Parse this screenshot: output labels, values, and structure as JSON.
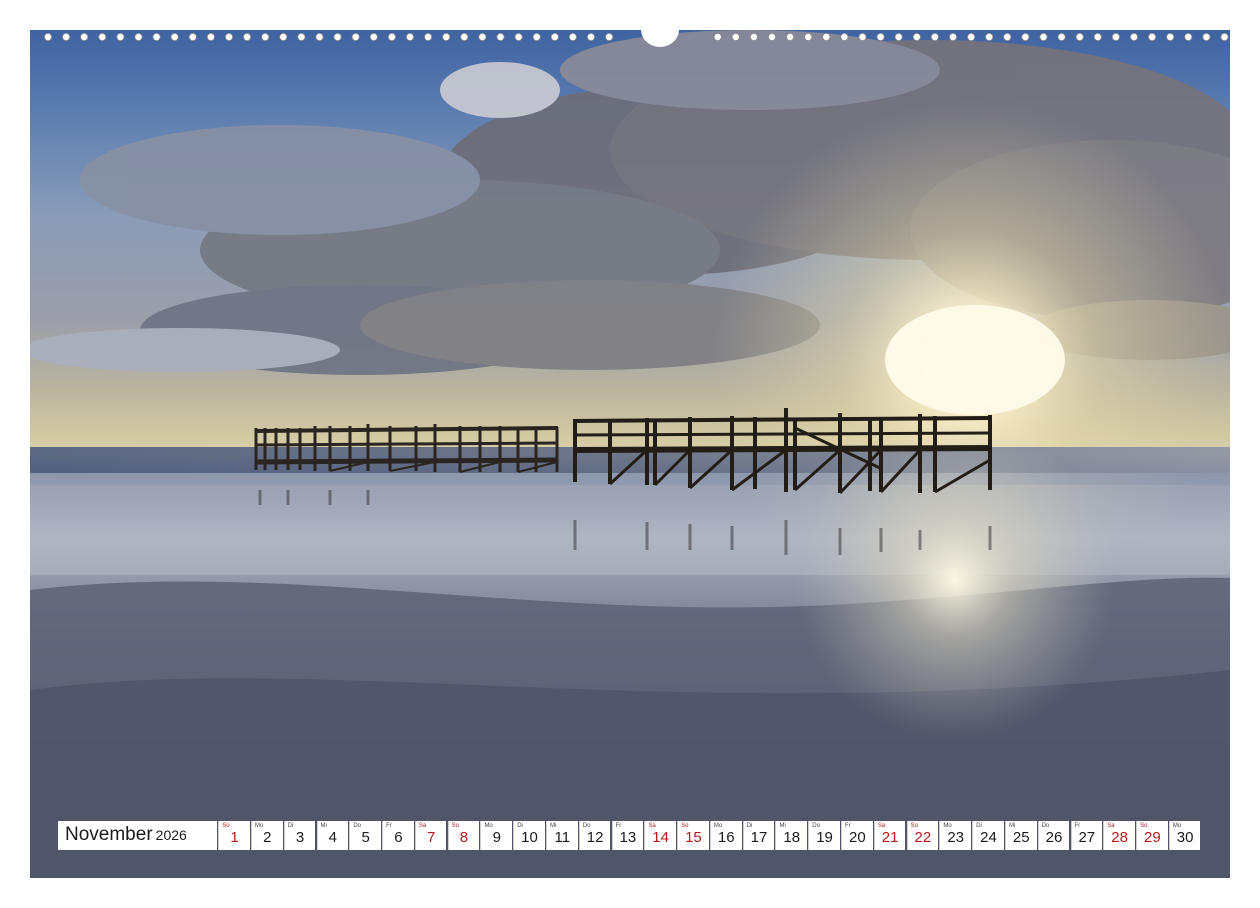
{
  "calendar": {
    "month": "November",
    "year": "2026",
    "weekend_color": "#b51919",
    "days": [
      {
        "dow": "So",
        "day": "1",
        "weekend": true
      },
      {
        "dow": "Mo",
        "day": "2",
        "weekend": false
      },
      {
        "dow": "Di",
        "day": "3",
        "weekend": false
      },
      {
        "dow": "Mi",
        "day": "4",
        "weekend": false
      },
      {
        "dow": "Do",
        "day": "5",
        "weekend": false
      },
      {
        "dow": "Fr",
        "day": "6",
        "weekend": false
      },
      {
        "dow": "Sa",
        "day": "7",
        "weekend": true
      },
      {
        "dow": "So",
        "day": "8",
        "weekend": true
      },
      {
        "dow": "Mo",
        "day": "9",
        "weekend": false
      },
      {
        "dow": "Di",
        "day": "10",
        "weekend": false
      },
      {
        "dow": "Mi",
        "day": "11",
        "weekend": false
      },
      {
        "dow": "Do",
        "day": "12",
        "weekend": false
      },
      {
        "dow": "Fr",
        "day": "13",
        "weekend": false
      },
      {
        "dow": "Sa",
        "day": "14",
        "weekend": true
      },
      {
        "dow": "So",
        "day": "15",
        "weekend": true
      },
      {
        "dow": "Mo",
        "day": "16",
        "weekend": false
      },
      {
        "dow": "Di",
        "day": "17",
        "weekend": false
      },
      {
        "dow": "Mi",
        "day": "18",
        "weekend": false
      },
      {
        "dow": "Do",
        "day": "19",
        "weekend": false
      },
      {
        "dow": "Fr",
        "day": "20",
        "weekend": false
      },
      {
        "dow": "Sa",
        "day": "21",
        "weekend": true
      },
      {
        "dow": "So",
        "day": "22",
        "weekend": true
      },
      {
        "dow": "Mo",
        "day": "23",
        "weekend": false
      },
      {
        "dow": "Di",
        "day": "24",
        "weekend": false
      },
      {
        "dow": "Mi",
        "day": "25",
        "weekend": false
      },
      {
        "dow": "Do",
        "day": "26",
        "weekend": false
      },
      {
        "dow": "Fr",
        "day": "27",
        "weekend": false
      },
      {
        "dow": "Sa",
        "day": "28",
        "weekend": true
      },
      {
        "dow": "So",
        "day": "29",
        "weekend": true
      },
      {
        "dow": "Mo",
        "day": "30",
        "weekend": false
      }
    ]
  }
}
